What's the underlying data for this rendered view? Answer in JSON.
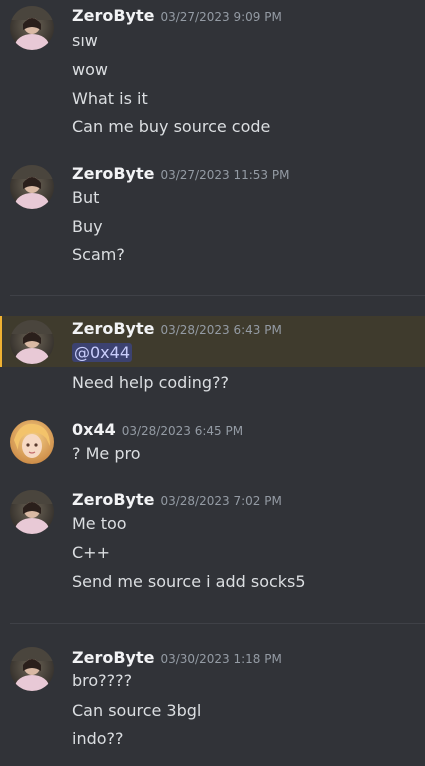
{
  "colors": {
    "background": "#313338",
    "author": "#f2f3f5",
    "text": "#dbdee1",
    "timestamp": "#949ba4",
    "mention_bg": "#3c4270",
    "mention_text": "#c9cdfb",
    "highlight_bg": "#3f3b2d",
    "highlight_border": "#f0b232"
  },
  "messages": [
    {
      "author": "ZeroByte",
      "timestamp": "03/27/2023 9:09 PM",
      "lines": [
        "sıw",
        "wow",
        "What is it",
        "Can me buy source code"
      ]
    },
    {
      "author": "ZeroByte",
      "timestamp": "03/27/2023 11:53 PM",
      "lines": [
        "But",
        "Buy",
        "Scam?"
      ]
    },
    {
      "author": "ZeroByte",
      "timestamp": "03/28/2023 6:43 PM",
      "mention": "@0x44",
      "lines": [
        "Need help coding??"
      ]
    },
    {
      "author": "0x44",
      "timestamp": "03/28/2023 6:45 PM",
      "lines": [
        "? Me pro"
      ]
    },
    {
      "author": "ZeroByte",
      "timestamp": "03/28/2023 7:02 PM",
      "lines": [
        "Me too",
        "C++",
        "Send me source i add socks5"
      ]
    },
    {
      "author": "ZeroByte",
      "timestamp": "03/30/2023 1:18 PM",
      "lines": [
        "bro????",
        "Can source 3bgl",
        "indo??"
      ]
    }
  ]
}
